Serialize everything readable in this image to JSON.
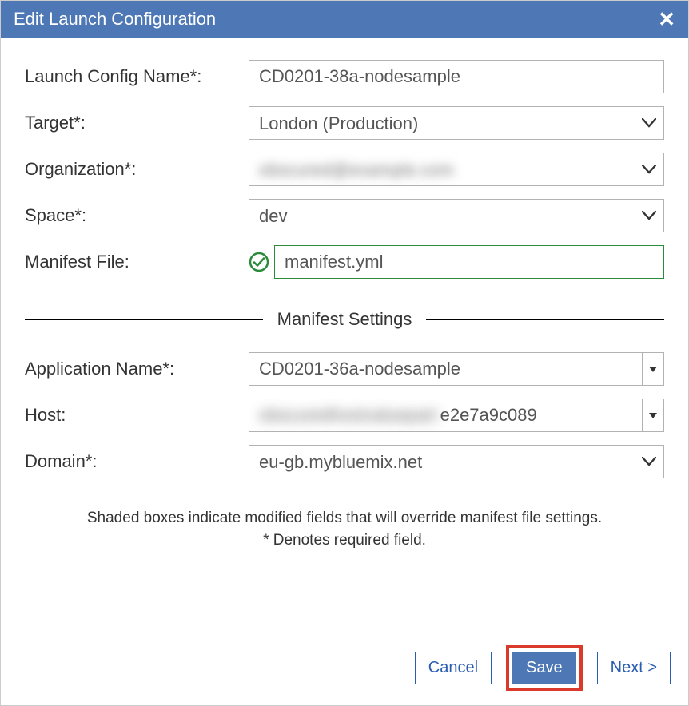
{
  "title": "Edit Launch Configuration",
  "fields": {
    "launch_config_name": {
      "label": "Launch Config Name*:",
      "value": "CD0201-38a-nodesample"
    },
    "target": {
      "label": "Target*:",
      "value": "London (Production)"
    },
    "organization": {
      "label": "Organization*:",
      "value": "obscured@example.com"
    },
    "space": {
      "label": "Space*:",
      "value": "dev"
    },
    "manifest_file": {
      "label": "Manifest File:",
      "value": "manifest.yml"
    },
    "application_name": {
      "label": "Application Name*:",
      "value": "CD0201-36a-nodesample"
    },
    "host": {
      "label": "Host:",
      "blurred_prefix": "obscuredhostvaluepart",
      "visible_suffix": "e2e7a9c089"
    },
    "domain": {
      "label": "Domain*:",
      "value": "eu-gb.mybluemix.net"
    }
  },
  "manifest_section_label": "Manifest Settings",
  "footnote_line1": "Shaded boxes indicate modified fields that will override manifest file settings.",
  "footnote_line2": "* Denotes required field.",
  "buttons": {
    "cancel": "Cancel",
    "save": "Save",
    "next": "Next >"
  }
}
